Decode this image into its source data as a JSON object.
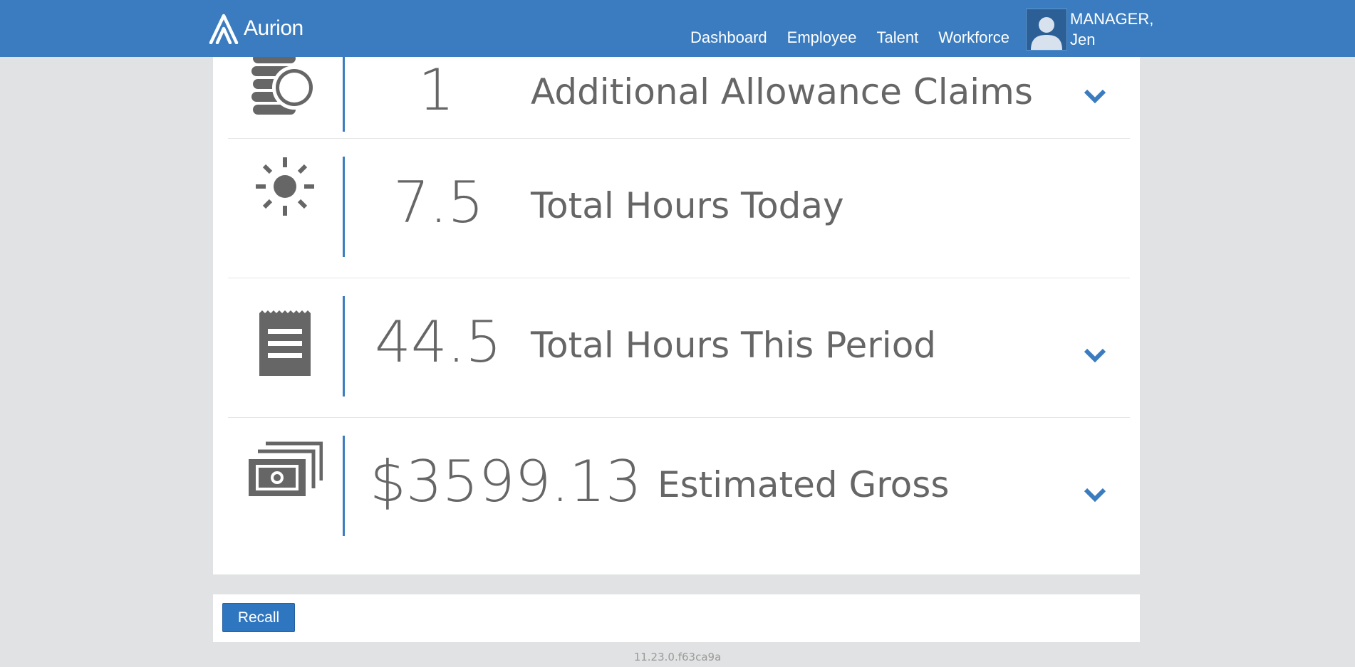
{
  "header": {
    "brand": "Aurion",
    "nav": [
      "Dashboard",
      "Employee",
      "Talent",
      "Workforce"
    ],
    "user_line1": "MANAGER,",
    "user_line2": "Jen"
  },
  "rows": [
    {
      "icon": "coins-icon",
      "value": "1",
      "label": "Additional Allowance Claims",
      "expandable": true
    },
    {
      "icon": "sun-icon",
      "value": "7.5",
      "label": "Total Hours Today",
      "expandable": false
    },
    {
      "icon": "receipt-icon",
      "value": "44.5",
      "label": "Total Hours This Period",
      "expandable": true
    },
    {
      "icon": "money-stack-icon",
      "value": "$3599.13",
      "label": "Estimated Gross",
      "expandable": true
    }
  ],
  "actions": {
    "recall_label": "Recall"
  },
  "footer": {
    "version": "11.23.0.f63ca9a"
  },
  "colors": {
    "header_bg": "#3a7cbf",
    "accent": "#3a7cbf",
    "text": "#666666",
    "page_bg": "#e1e2e3"
  }
}
